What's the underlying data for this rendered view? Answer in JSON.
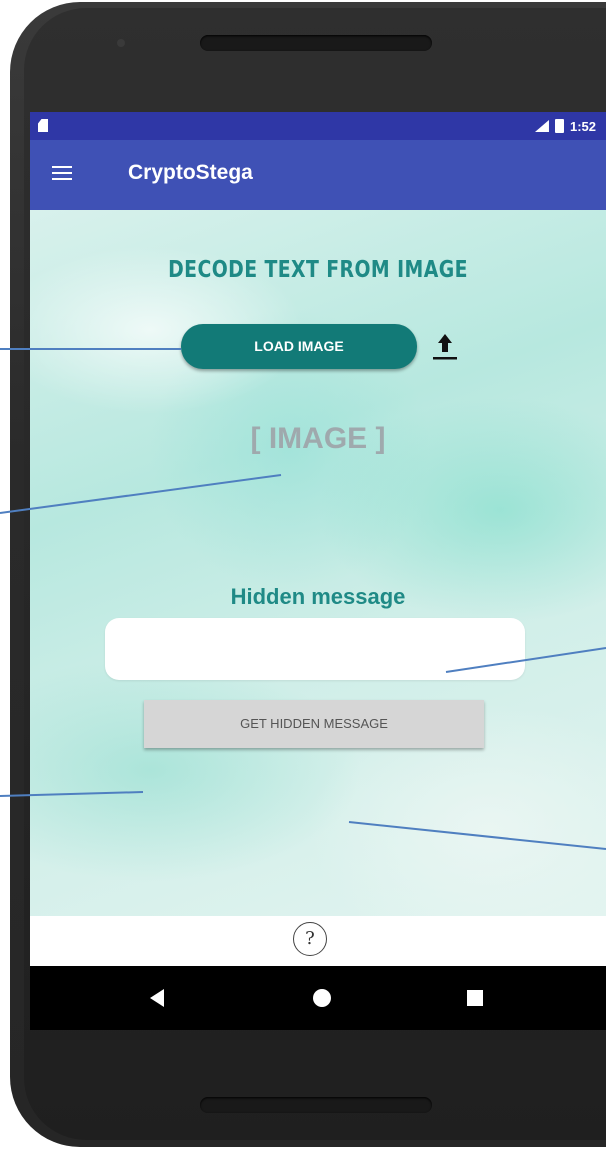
{
  "status_bar": {
    "time": "1:52"
  },
  "app_bar": {
    "title": "CryptoStega",
    "menu_icon": "hamburger-menu-icon"
  },
  "main": {
    "heading": "DECODE TEXT FROM IMAGE",
    "load_button_label": "LOAD IMAGE",
    "upload_icon": "upload-arrow-icon",
    "image_placeholder": "[ IMAGE ]",
    "hidden_message_label": "Hidden message",
    "hidden_message_value": "",
    "get_button_label": "GET HIDDEN MESSAGE"
  },
  "bottom_bar": {
    "help_icon": "help-question-icon",
    "help_glyph": "?"
  },
  "colors": {
    "status_bar": "#2f37a6",
    "app_bar": "#3f51b5",
    "accent_teal": "#127a77",
    "heading_teal": "#1f8a86",
    "callout_line": "#4f7fc0"
  }
}
